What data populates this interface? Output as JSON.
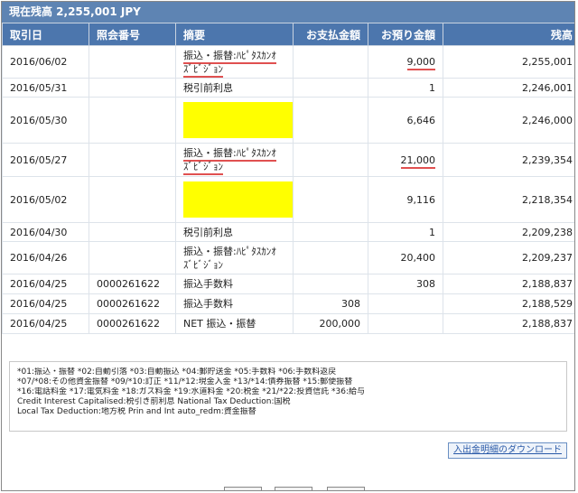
{
  "header": {
    "balance_text": "現在残高 2,255,001 JPY"
  },
  "table": {
    "columns": [
      "取引日",
      "照会番号",
      "摘要",
      "お支払金額",
      "お預り金額",
      "残高"
    ],
    "rows": [
      {
        "date": "2016/06/02",
        "ref": "",
        "desc": "振込・振替:ﾊﾋﾟﾀｽｶﾝｵｽﾞﾋﾞｼﾞｮﾝ",
        "debit": "",
        "credit": "9,000",
        "balance": "2,255,001"
      },
      {
        "date": "2016/05/31",
        "ref": "",
        "desc": "税引前利息",
        "debit": "",
        "credit": "1",
        "balance": "2,246,001"
      },
      {
        "date": "2016/05/30",
        "ref": "",
        "desc": "",
        "debit": "",
        "credit": "6,646",
        "balance": "2,246,000"
      },
      {
        "date": "2016/05/27",
        "ref": "",
        "desc": "振込・振替:ﾊﾋﾟﾀｽｶﾝｵｽﾞﾋﾞｼﾞｮﾝ",
        "debit": "",
        "credit": "21,000",
        "balance": "2,239,354"
      },
      {
        "date": "2016/05/02",
        "ref": "",
        "desc": "",
        "debit": "",
        "credit": "9,116",
        "balance": "2,218,354"
      },
      {
        "date": "2016/04/30",
        "ref": "",
        "desc": "税引前利息",
        "debit": "",
        "credit": "1",
        "balance": "2,209,238"
      },
      {
        "date": "2016/04/26",
        "ref": "",
        "desc": "振込・振替:ﾊﾋﾟﾀｽｶﾝｵｽﾞﾋﾞｼﾞｮﾝ",
        "debit": "",
        "credit": "20,400",
        "balance": "2,209,237"
      },
      {
        "date": "2016/04/25",
        "ref": "0000261622",
        "desc": "振込手数料",
        "debit": "",
        "credit": "308",
        "balance": "2,188,837"
      },
      {
        "date": "2016/04/25",
        "ref": "0000261622",
        "desc": "振込手数料",
        "debit": "308",
        "credit": "",
        "balance": "2,188,529"
      },
      {
        "date": "2016/04/25",
        "ref": "0000261622",
        "desc": "NET 振込・振替",
        "debit": "200,000",
        "credit": "",
        "balance": "2,188,837"
      }
    ]
  },
  "legend": {
    "lines": [
      "*01:振込・振替 *02:自動引落 *03:自動振込 *04:郵貯送金 *05:手数料 *06:手数料返戻",
      "*07/*08:その他資金振替 *09/*10:訂正 *11/*12:現金入金 *13/*14:債券振替 *15:郵便振替",
      "*16:電話料金 *17:電気料金 *18:ガス料金 *19:水道料金 *20:税金 *21/*22:投資信託 *36:給与",
      "Credit Interest Capitalised:税引き前利息 National Tax Deduction:国税",
      "Local Tax Deduction:地方税  Prin and Int auto_redm:資金振替"
    ]
  },
  "actions": {
    "download_label": "入出金明細のダウンロード"
  },
  "colors": {
    "header_bg": "#4c76ad",
    "balance_bar_bg": "#5e84b3",
    "redaction": "#ffff00",
    "annotation_underline": "#e05050"
  }
}
